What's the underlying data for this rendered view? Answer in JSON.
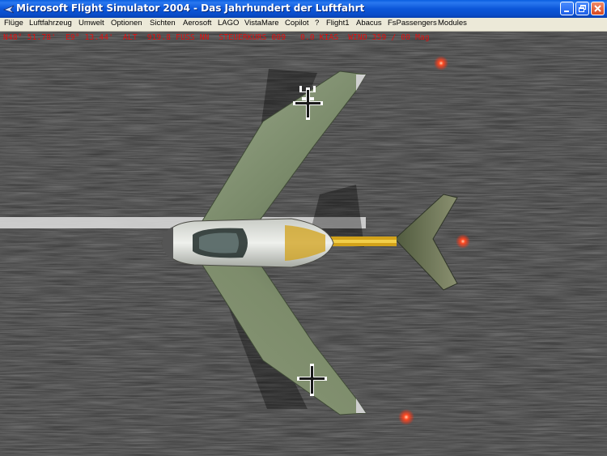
{
  "window": {
    "title": "Microsoft Flight Simulator 2004 - Das Jahrhundert der Luftfahrt",
    "controls": [
      "minimize",
      "maximize",
      "close"
    ]
  },
  "menubar": {
    "items": [
      {
        "label": "Flüge"
      },
      {
        "label": "Luftfahrzeug"
      },
      {
        "label": "Umwelt"
      },
      {
        "label": "Optionen"
      },
      {
        "label": "Sichten"
      },
      {
        "label": "Aerosoft"
      },
      {
        "label": "LAGO"
      },
      {
        "label": "VistaMare"
      },
      {
        "label": "Copilot"
      },
      {
        "label": "?"
      },
      {
        "label": "Flight1"
      },
      {
        "label": "Abacus"
      },
      {
        "label": "FsPassengers"
      },
      {
        "label": "Modules"
      }
    ]
  },
  "hud": {
    "text": "N48° 51.78'  E9° 13.44'  ALT  919.8 FUSS NN  STEUERKURS 009   0.0 KIAS  WIND 359 / 00 Mag"
  },
  "colors": {
    "hud_text": "#e01010",
    "titlebar": "#0a56d8",
    "menubar": "#ece9d8",
    "runway": "#7a7a7a",
    "aircraft_wing": "#7f9070",
    "aircraft_tail_stripe": "#d2a21a",
    "runway_light": "#ff3a1a"
  }
}
